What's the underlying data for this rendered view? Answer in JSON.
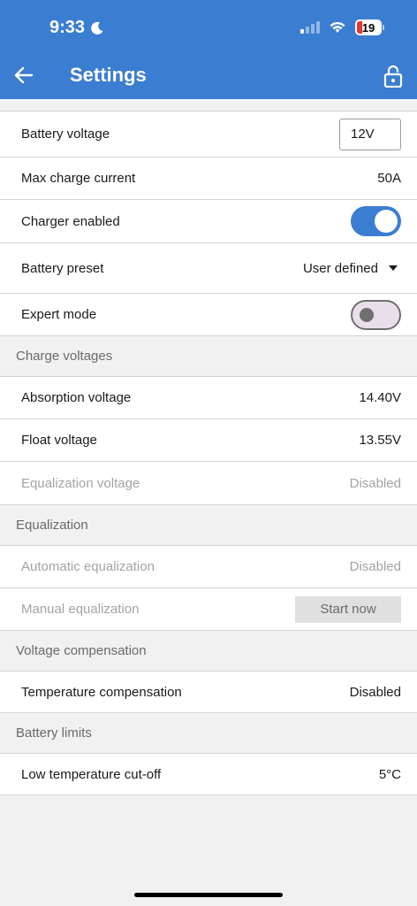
{
  "status_bar": {
    "time": "9:33",
    "battery": "19"
  },
  "header": {
    "title": "Settings"
  },
  "settings": {
    "battery_voltage": {
      "label": "Battery voltage",
      "value": "12V"
    },
    "max_charge_current": {
      "label": "Max charge current",
      "value": "50A"
    },
    "charger_enabled": {
      "label": "Charger enabled",
      "state": "on"
    },
    "battery_preset": {
      "label": "Battery preset",
      "value": "User defined"
    },
    "expert_mode": {
      "label": "Expert mode",
      "state": "off"
    }
  },
  "charge_voltages": {
    "title": "Charge voltages",
    "absorption": {
      "label": "Absorption voltage",
      "value": "14.40V"
    },
    "float": {
      "label": "Float voltage",
      "value": "13.55V"
    },
    "equalization": {
      "label": "Equalization voltage",
      "value": "Disabled"
    }
  },
  "equalization": {
    "title": "Equalization",
    "automatic": {
      "label": "Automatic equalization",
      "value": "Disabled"
    },
    "manual": {
      "label": "Manual equalization",
      "button": "Start now"
    }
  },
  "voltage_compensation": {
    "title": "Voltage compensation",
    "temperature": {
      "label": "Temperature compensation",
      "value": "Disabled"
    }
  },
  "battery_limits": {
    "title": "Battery limits",
    "low_temp_cutoff": {
      "label": "Low temperature cut-off",
      "value": "5°C"
    }
  },
  "colors": {
    "accent": "#3b7dd1",
    "background": "#f1f1f1"
  }
}
